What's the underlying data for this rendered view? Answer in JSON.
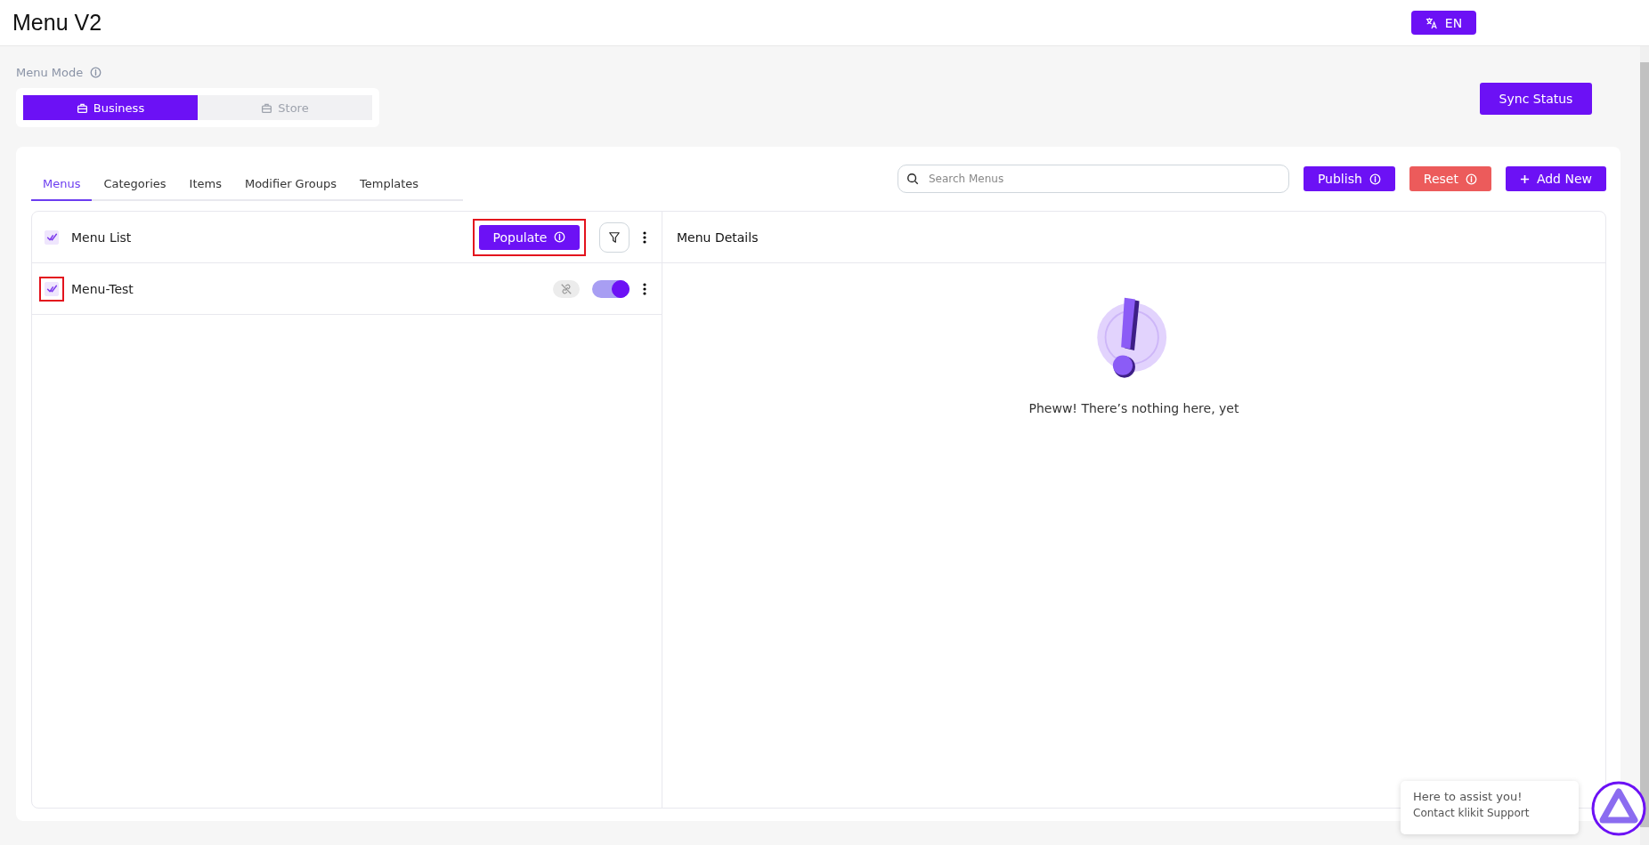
{
  "header": {
    "title": "Menu V2",
    "language_button": "EN"
  },
  "menu_mode": {
    "label": "Menu Mode",
    "options": [
      {
        "label": "Business",
        "selected": true
      },
      {
        "label": "Store",
        "selected": false
      }
    ]
  },
  "sync_button": "Sync Status",
  "tabs": [
    {
      "label": "Menus",
      "selected": true
    },
    {
      "label": "Categories",
      "selected": false
    },
    {
      "label": "Items",
      "selected": false
    },
    {
      "label": "Modifier Groups",
      "selected": false
    },
    {
      "label": "Templates",
      "selected": false
    }
  ],
  "search": {
    "placeholder": "Search Menus"
  },
  "actions": [
    {
      "label": "Publish",
      "kind": "primary",
      "info": true
    },
    {
      "label": "Reset",
      "kind": "danger",
      "info": true
    },
    {
      "label": "Add New",
      "kind": "add",
      "info": false
    }
  ],
  "menu_list": {
    "title": "Menu List",
    "checked": true,
    "populate_button": "Populate",
    "populate_highlighted": true,
    "rows": [
      {
        "name": "Menu-Test",
        "checked": true,
        "highlighted": true,
        "linked": false,
        "on": true
      }
    ]
  },
  "menu_details": {
    "title": "Menu Details",
    "empty_message": "Pheww! There’s nothing here, yet"
  },
  "support": {
    "title": "Here to assist you!",
    "subtitle": "Contact klikit Support"
  }
}
